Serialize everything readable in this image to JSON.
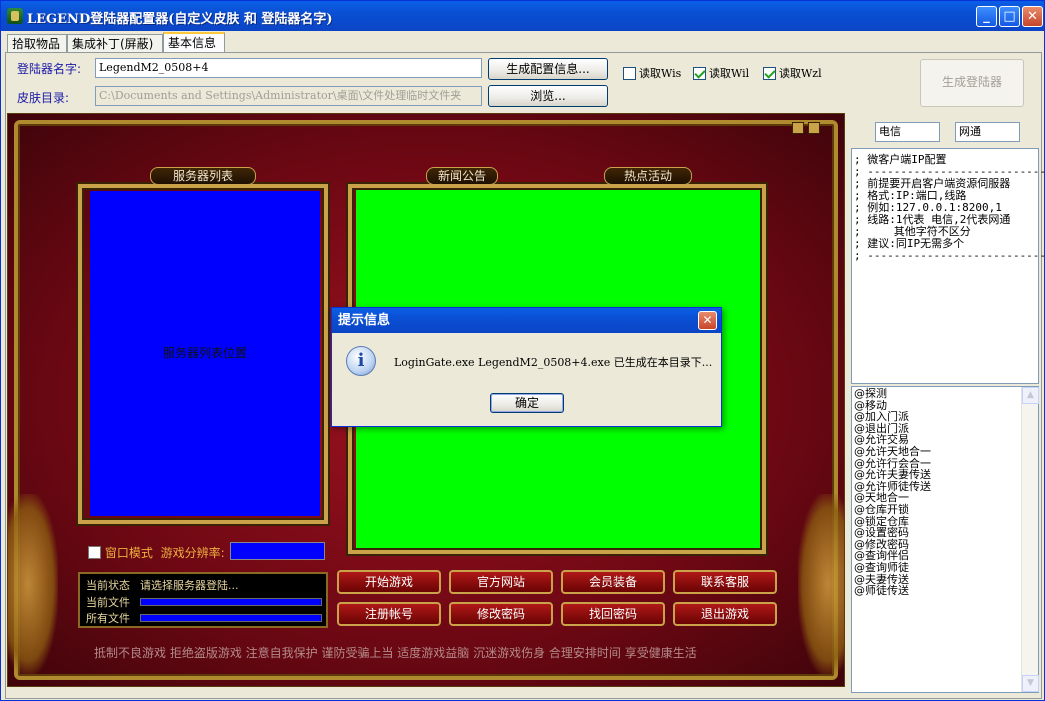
{
  "window": {
    "title": "LEGEND登陆器配置器(自定义皮肤 和 登陆器名字)",
    "min": "_",
    "max": "□",
    "close": "✕"
  },
  "tabs": [
    {
      "label": "拾取物品"
    },
    {
      "label": "集成补丁(屏蔽)"
    },
    {
      "label": "基本信息"
    }
  ],
  "form": {
    "name_label": "登陆器名字:",
    "name_value": "LegendM2_0508+4",
    "skin_label": "皮肤目录:",
    "skin_value": "C:\\Documents and Settings\\Administrator\\桌面\\文件处理临时文件夹",
    "gen_config_btn": "生成配置信息...",
    "browse_btn": "浏览...",
    "gen_launcher_btn": "生成登陆器",
    "checks": [
      {
        "label": "读取Wis",
        "checked": false
      },
      {
        "label": "读取Wil",
        "checked": true
      },
      {
        "label": "读取Wzl",
        "checked": true
      }
    ]
  },
  "skin": {
    "server_list_title": "服务器列表",
    "server_list_placeholder": "服务器列表位置",
    "news_title": "新闻公告",
    "hot_title": "热点活动",
    "window_mode_label": "窗口模式",
    "resolution_label": "游戏分辨率:",
    "status_label": "当前状态",
    "status_text": "请选择服务器登陆...",
    "current_file_label": "当前文件",
    "all_files_label": "所有文件",
    "buttons": [
      "开始游戏",
      "官方网站",
      "会员装备",
      "联系客服",
      "注册帐号",
      "修改密码",
      "找回密码",
      "退出游戏"
    ],
    "slogan": "抵制不良游戏  拒绝盗版游戏  注意自我保护  谨防受骗上当  适度游戏益脑  沉迷游戏伤身  合理安排时间  享受健康生活"
  },
  "right": {
    "line1": "电信",
    "line2": "网通",
    "ip_config": "; 微客户端IP配置\n; ----------------------------\n; 前提要开启客户端资源伺服器\n; 格式:IP:端口,线路\n; 例如:127.0.0.1:8200,1\n; 线路:1代表 电信,2代表网通\n;     其他字符不区分\n; 建议:同IP无需多个\n; ----------------------------",
    "commands": [
      "@探测",
      "@移动",
      "@加入门派",
      "@退出门派",
      "@允许交易",
      "@允许天地合一",
      "@允许行会合一",
      "@允许夫妻传送",
      "@允许师徒传送",
      "@天地合一",
      "@仓库开锁",
      "@锁定仓库",
      "@设置密码",
      "@修改密码",
      "@查询伴侣",
      "@查询师徒",
      "@夫妻传送",
      "@师徒传送"
    ]
  },
  "dialog": {
    "title": "提示信息",
    "message": "LoginGate.exe LegendM2_0508+4.exe 已生成在本目录下...",
    "ok": "确定",
    "close": "✕",
    "icon_glyph": "i"
  }
}
